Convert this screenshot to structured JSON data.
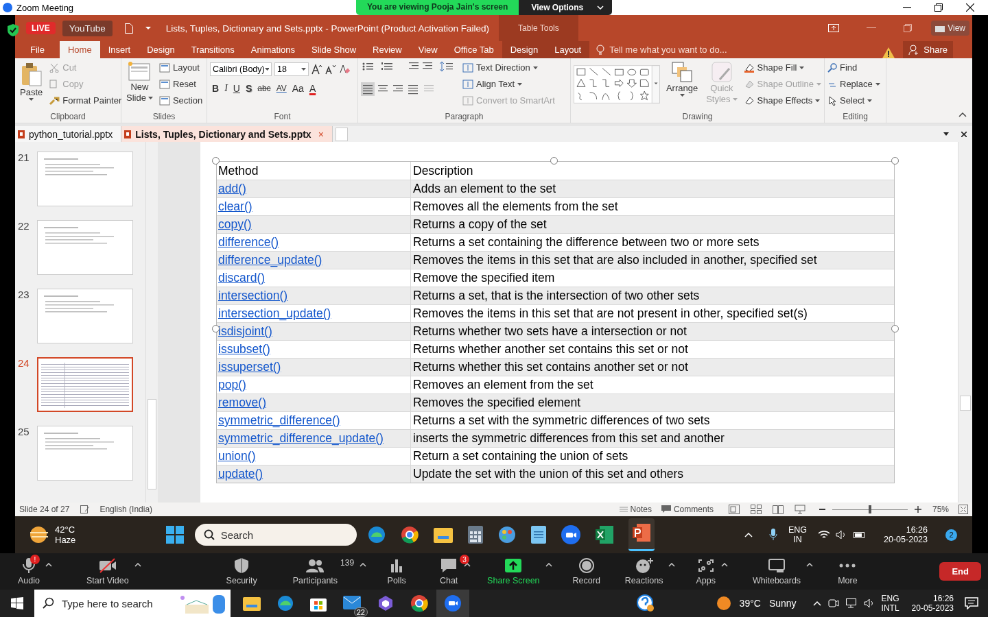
{
  "zoom_window": {
    "title": "Zoom Meeting",
    "banner": "You are viewing Pooja Jain's screen",
    "view_options": "View Options"
  },
  "stream": {
    "live": "LIVE",
    "platform": "YouTube"
  },
  "powerpoint": {
    "title": "Lists, Tuples, Dictionary and Sets.pptx - PowerPoint (Product Activation Failed)",
    "context_tab_group": "Table Tools",
    "view_button": "View",
    "tabs": [
      {
        "label": "File",
        "selected": false
      },
      {
        "label": "Home",
        "selected": true
      },
      {
        "label": "Insert",
        "selected": false
      },
      {
        "label": "Design",
        "selected": false
      },
      {
        "label": "Transitions",
        "selected": false
      },
      {
        "label": "Animations",
        "selected": false
      },
      {
        "label": "Slide Show",
        "selected": false
      },
      {
        "label": "Review",
        "selected": false
      },
      {
        "label": "View",
        "selected": false
      },
      {
        "label": "Office Tab",
        "selected": false
      },
      {
        "label": "Design",
        "selected": false
      },
      {
        "label": "Layout",
        "selected": false
      }
    ],
    "tell_me": {
      "placeholder": "Tell me what you want to do..."
    },
    "share": "Share",
    "ribbon": {
      "clipboard": {
        "label": "Clipboard",
        "paste": "Paste",
        "items": [
          {
            "label": "Cut",
            "disabled": true
          },
          {
            "label": "Copy",
            "disabled": true
          },
          {
            "label": "Format Painter",
            "disabled": false
          }
        ]
      },
      "slides": {
        "label": "Slides",
        "new_slide": [
          "New",
          "Slide"
        ],
        "items": [
          "Layout",
          "Reset",
          "Section"
        ]
      },
      "font": {
        "label": "Font",
        "family": "Calibri (Body)",
        "size": "18",
        "buttons": [
          "B",
          "I",
          "U",
          "S",
          "abc",
          "AV",
          "Aa",
          "A"
        ]
      },
      "paragraph": {
        "label": "Paragraph",
        "items": [
          {
            "label": "Text Direction",
            "disabled": false
          },
          {
            "label": "Align Text",
            "disabled": false
          },
          {
            "label": "Convert to SmartArt",
            "disabled": true
          }
        ]
      },
      "drawing": {
        "label": "Drawing",
        "arrange": "Arrange",
        "quick_styles": {
          "label": [
            "Quick",
            "Styles"
          ],
          "disabled": true
        },
        "items": [
          {
            "label": "Shape Fill",
            "disabled": false
          },
          {
            "label": "Shape Outline",
            "disabled": true
          },
          {
            "label": "Shape Effects",
            "disabled": false
          }
        ]
      },
      "editing": {
        "label": "Editing",
        "items": [
          "Find",
          "Replace",
          "Select"
        ]
      }
    },
    "documents": [
      {
        "name": "python_tutorial.pptx",
        "selected": false
      },
      {
        "name": "Lists, Tuples, Dictionary and Sets.pptx",
        "selected": true,
        "close": "×"
      }
    ],
    "slides": [
      {
        "number": "21",
        "selected": false
      },
      {
        "number": "22",
        "selected": false
      },
      {
        "number": "23",
        "selected": false
      },
      {
        "number": "24",
        "selected": true
      },
      {
        "number": "25",
        "selected": false
      }
    ],
    "table": {
      "columns": [
        "Method",
        "Description"
      ],
      "rows": [
        {
          "method": "add()",
          "description": "Adds an element to the set"
        },
        {
          "method": "clear()",
          "description": "Removes all the elements from the set"
        },
        {
          "method": "copy()",
          "description": "Returns a copy of the set"
        },
        {
          "method": "difference()",
          "description": "Returns a set containing the difference between two or more sets"
        },
        {
          "method": "difference_update()",
          "description": "Removes the items in this set that are also included in another, specified set"
        },
        {
          "method": "discard()",
          "description": "Remove the specified item"
        },
        {
          "method": "intersection()",
          "description": "Returns a set, that is the intersection of two other sets"
        },
        {
          "method": "intersection_update()",
          "description": "Removes the items in this set that are not present in other, specified set(s)"
        },
        {
          "method": "isdisjoint()",
          "description": "Returns whether two sets have a intersection or not"
        },
        {
          "method": "issubset()",
          "description": "Returns whether another set contains this set or not"
        },
        {
          "method": "issuperset()",
          "description": "Returns whether this set contains another set or not"
        },
        {
          "method": "pop()",
          "description": "Removes an element from the set"
        },
        {
          "method": "remove()",
          "description": "Removes the specified element"
        },
        {
          "method": "symmetric_difference()",
          "description": "Returns a set with the symmetric differences of two sets"
        },
        {
          "method": "symmetric_difference_update()",
          "description": "inserts the symmetric differences from this set and another"
        },
        {
          "method": "union()",
          "description": "Return a set containing the union of sets"
        },
        {
          "method": "update()",
          "description": "Update the set with the union of this set and others"
        }
      ]
    },
    "status_bar": {
      "slide": "Slide 24 of 27",
      "language": "English (India)",
      "notes": "Notes",
      "comments": "Comments",
      "zoom": {
        "level": 0.5
      },
      "zoom_reading": "75%"
    }
  },
  "shared_taskbar": {
    "weather": {
      "temp": "42°C",
      "condition": "Haze"
    },
    "search": {
      "placeholder": "Search"
    },
    "lang": [
      "ENG",
      "IN"
    ],
    "time": "16:26",
    "date": "20-05-2023",
    "notifications": "2"
  },
  "zoom_toolbar": {
    "items": [
      {
        "label": "Audio",
        "badge": "!"
      },
      {
        "label": "Start Video"
      },
      {
        "label": "Security"
      },
      {
        "label": "Participants",
        "count": "139"
      },
      {
        "label": "Polls"
      },
      {
        "label": "Chat",
        "badge": "3"
      },
      {
        "label": "Share Screen"
      },
      {
        "label": "Record"
      },
      {
        "label": "Reactions"
      },
      {
        "label": "Apps"
      },
      {
        "label": "Whiteboards"
      },
      {
        "label": "More"
      }
    ],
    "end": "End"
  },
  "taskbar": {
    "search": {
      "placeholder": "Type here to search"
    },
    "mail_badge": "22",
    "weather": {
      "temp": "39°C",
      "condition": "Sunny"
    },
    "lang": [
      "ENG",
      "INTL"
    ],
    "time": "16:26",
    "date": "20-05-2023"
  }
}
